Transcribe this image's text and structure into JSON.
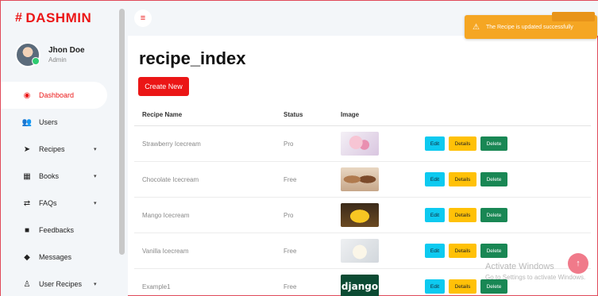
{
  "brand": {
    "icon": "hashtag-icon",
    "name": "DASHMIN",
    "color": "#eb1616"
  },
  "user": {
    "name": "Jhon Doe",
    "role": "Admin"
  },
  "sidebar": {
    "items": [
      {
        "label": "Dashboard",
        "icon": "tachometer-icon",
        "active": true
      },
      {
        "label": "Users",
        "icon": "users-icon"
      },
      {
        "label": "Recipes",
        "icon": "recipe-icon",
        "chevron": "▾"
      },
      {
        "label": "Books",
        "icon": "book-icon",
        "chevron": "▾"
      },
      {
        "label": "FAQs",
        "icon": "faq-icon",
        "chevron": "▾"
      },
      {
        "label": "Feedbacks",
        "icon": "comment-icon"
      },
      {
        "label": "Messages",
        "icon": "messages-icon"
      },
      {
        "label": "User Recipes",
        "icon": "user-recipe-icon",
        "chevron": "▾"
      }
    ]
  },
  "toast": {
    "message": "The Recipe is updated successfully",
    "icon": "warning-icon",
    "color": "#f5a623"
  },
  "page": {
    "title": "recipe_index",
    "create_label": "Create New"
  },
  "table": {
    "headers": [
      "Recipe Name",
      "Status",
      "Image",
      ""
    ],
    "rows": [
      {
        "name": "Strawberry Icecream",
        "status": "Pro",
        "image": "strawberry-icecream-image"
      },
      {
        "name": "Chocolate Icecream",
        "status": "Free",
        "image": "chocolate-icecream-image"
      },
      {
        "name": "Mango Icecream",
        "status": "Pro",
        "image": "mango-icecream-image"
      },
      {
        "name": "Vanilla Icecream",
        "status": "Free",
        "image": "vanilla-icecream-image"
      },
      {
        "name": "Example1",
        "status": "Free",
        "image": "django-logo-image",
        "image_text": "django"
      }
    ],
    "actions": {
      "edit": "Edit",
      "details": "Details",
      "delete": "Delete"
    }
  },
  "watermark": {
    "title": "Activate Windows",
    "subtitle": "Go to Settings to activate Windows."
  },
  "colors": {
    "edit": "#0dcaf0",
    "details": "#ffc107",
    "delete": "#198754",
    "primary": "#eb1616"
  }
}
